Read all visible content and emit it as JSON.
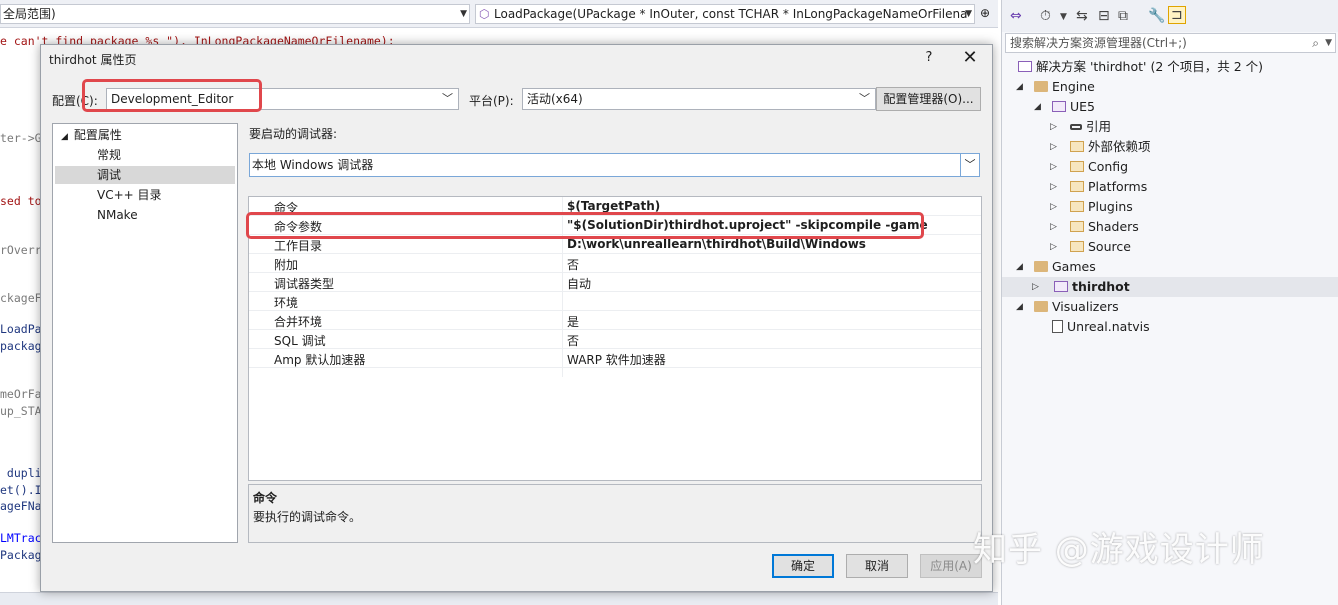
{
  "editor": {
    "scope_combo": "全局范围)",
    "function_combo": "LoadPackage(UPackage * InOuter, const TCHAR * InLongPackageNameOrFilena",
    "code_lines": [
      {
        "text": "e can't find package %s \"), InLongPackageNameOrFilename);",
        "cls": "c-red"
      },
      {
        "text": "ter->G",
        "cls": "c-grey"
      },
      {
        "text": "sed to",
        "cls": "c-red"
      },
      {
        "text": "rOverr",
        "cls": "c-grey"
      },
      {
        "text": "ckageF",
        "cls": "c-grey"
      },
      {
        "text": "LoadPa",
        "cls": "c-navy"
      },
      {
        "text": "packag",
        "cls": "c-navy"
      },
      {
        "text": "meOrFa",
        "cls": "c-grey"
      },
      {
        "text": "up_STA",
        "cls": "c-grey"
      },
      {
        "text": " dupli",
        "cls": "c-navy"
      },
      {
        "text": "et().I",
        "cls": "c-navy"
      },
      {
        "text": "ageFNa",
        "cls": "c-navy"
      },
      {
        "text": "LMTrac",
        "cls": "c-blue"
      },
      {
        "text": "Packag",
        "cls": "c-navy"
      }
    ]
  },
  "dialog": {
    "title": "thirdhot 属性页",
    "help": "?",
    "close": "✕",
    "config_label": "配置(C):",
    "config_value": "Development_Editor",
    "platform_label": "平台(P):",
    "platform_value": "活动(x64)",
    "config_manager": "配置管理器(O)...",
    "tree": {
      "root": "配置属性",
      "items": [
        "常规",
        "调试",
        "VC++ 目录",
        "NMake"
      ]
    },
    "debugger_label": "要启动的调试器:",
    "debugger_value": "本地 Windows 调试器",
    "props": [
      {
        "name": "命令",
        "value": "$(TargetPath)",
        "bold": true
      },
      {
        "name": "命令参数",
        "value": "\"$(SolutionDir)thirdhot.uproject\" -skipcompile -game",
        "bold": true
      },
      {
        "name": "工作目录",
        "value": "D:\\work\\unreallearn\\thirdhot\\Build\\Windows",
        "bold": true
      },
      {
        "name": "附加",
        "value": "否",
        "bold": false
      },
      {
        "name": "调试器类型",
        "value": "自动",
        "bold": false
      },
      {
        "name": "环境",
        "value": "",
        "bold": false
      },
      {
        "name": "合并环境",
        "value": "是",
        "bold": false
      },
      {
        "name": "SQL 调试",
        "value": "否",
        "bold": false
      },
      {
        "name": "Amp 默认加速器",
        "value": "WARP 软件加速器",
        "bold": false
      }
    ],
    "desc_title": "命令",
    "desc_text": "要执行的调试命令。",
    "ok": "确定",
    "cancel": "取消",
    "apply": "应用(A)"
  },
  "solution_explorer": {
    "search_placeholder": "搜索解决方案资源管理器(Ctrl+;)",
    "solution": "解决方案 'thirdhot' (2 个项目，共 2 个)",
    "engine": "Engine",
    "ue5": "UE5",
    "ue5_children": [
      "引用",
      "外部依赖项",
      "Config",
      "Platforms",
      "Plugins",
      "Shaders",
      "Source"
    ],
    "games": "Games",
    "thirdhot": "thirdhot",
    "visualizers": "Visualizers",
    "natvis": "Unreal.natvis"
  },
  "watermark": "知乎 @游戏设计师"
}
